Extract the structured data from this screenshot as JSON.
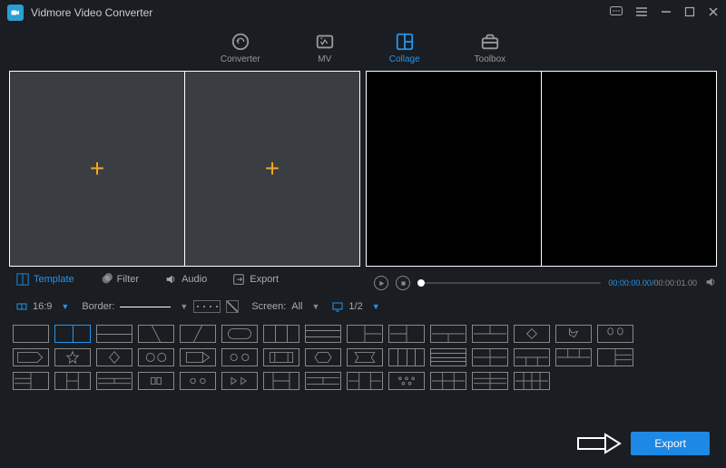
{
  "app": {
    "title": "Vidmore Video Converter"
  },
  "nav": {
    "converter": "Converter",
    "mv": "MV",
    "collage": "Collage",
    "toolbox": "Toolbox"
  },
  "optionTabs": {
    "template": "Template",
    "filter": "Filter",
    "audio": "Audio",
    "export": "Export"
  },
  "player": {
    "current": "00:00:00.00",
    "duration": "00:00:01.00"
  },
  "toolbar": {
    "ratio": "16:9",
    "borderLabel": "Border:",
    "screenLabel": "Screen:",
    "screenValue": "All",
    "pager": "1/2"
  },
  "footer": {
    "export": "Export"
  }
}
